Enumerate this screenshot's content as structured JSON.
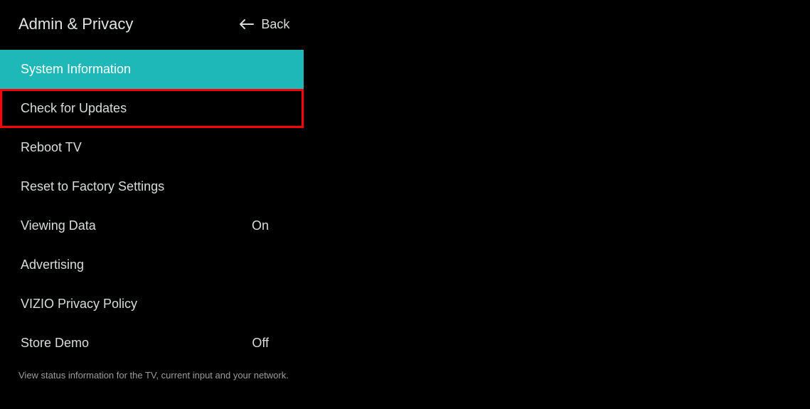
{
  "header": {
    "title": "Admin & Privacy",
    "back_label": "Back"
  },
  "menu": {
    "items": [
      {
        "label": "System Information",
        "value": "",
        "selected": true,
        "highlighted": false
      },
      {
        "label": "Check for Updates",
        "value": "",
        "selected": false,
        "highlighted": true
      },
      {
        "label": "Reboot TV",
        "value": "",
        "selected": false,
        "highlighted": false
      },
      {
        "label": "Reset to Factory Settings",
        "value": "",
        "selected": false,
        "highlighted": false
      },
      {
        "label": "Viewing Data",
        "value": "On",
        "selected": false,
        "highlighted": false
      },
      {
        "label": "Advertising",
        "value": "",
        "selected": false,
        "highlighted": false
      },
      {
        "label": "VIZIO Privacy Policy",
        "value": "",
        "selected": false,
        "highlighted": false
      },
      {
        "label": "Store Demo",
        "value": "Off",
        "selected": false,
        "highlighted": false
      }
    ]
  },
  "footer": {
    "description": "View status information for the TV, current input and your network."
  }
}
